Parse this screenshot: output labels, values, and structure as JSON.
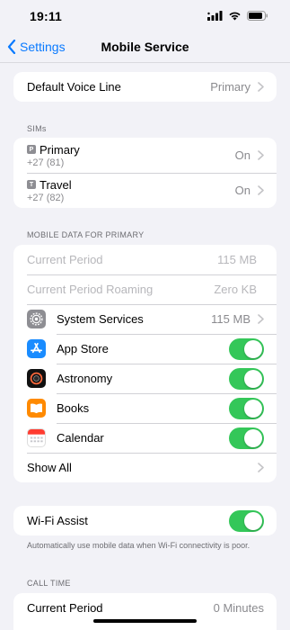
{
  "status_bar": {
    "time": "19:11"
  },
  "nav": {
    "back_label": "Settings",
    "title": "Mobile Service"
  },
  "default_voice": {
    "label": "Default Voice Line",
    "value": "Primary"
  },
  "sims": {
    "header": "SIMs",
    "items": [
      {
        "badge": "P",
        "name": "Primary",
        "number": "+27 (81)",
        "state": "On"
      },
      {
        "badge": "T",
        "name": "Travel",
        "number": "+27 (82)",
        "state": "On"
      }
    ]
  },
  "mobile_data": {
    "header": "MOBILE DATA FOR PRIMARY",
    "current_period": {
      "label": "Current Period",
      "value": "115 MB"
    },
    "current_roaming": {
      "label": "Current Period Roaming",
      "value": "Zero KB"
    },
    "system_services": {
      "label": "System Services",
      "value": "115 MB"
    },
    "apps": [
      {
        "name": "App Store",
        "icon": "app-store-icon",
        "enabled": true
      },
      {
        "name": "Astronomy",
        "icon": "astronomy-icon",
        "enabled": true
      },
      {
        "name": "Books",
        "icon": "books-icon",
        "enabled": true
      },
      {
        "name": "Calendar",
        "icon": "calendar-icon",
        "enabled": true
      }
    ],
    "show_all": "Show All"
  },
  "wifi_assist": {
    "label": "Wi-Fi Assist",
    "enabled": true,
    "note": "Automatically use mobile data when Wi-Fi connectivity is poor."
  },
  "call_time": {
    "header": "CALL TIME",
    "current_period": {
      "label": "Current Period",
      "value": "0 Minutes"
    }
  },
  "colors": {
    "accent": "#0a7aff",
    "toggle_on": "#34c759",
    "background": "#f2f2f7"
  }
}
